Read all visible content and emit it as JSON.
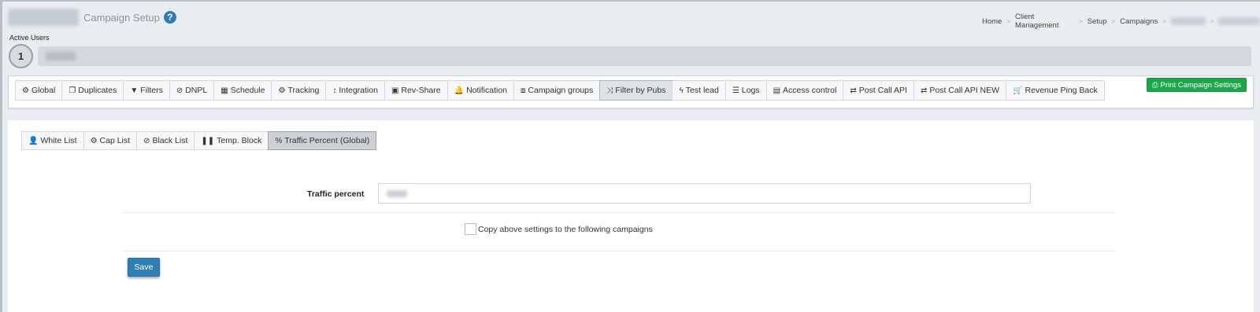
{
  "header": {
    "title": "Campaign Setup",
    "help_icon": "question-circle-icon"
  },
  "breadcrumb": [
    "Home",
    "Client Management",
    "Setup",
    "Campaigns"
  ],
  "active_users": {
    "label": "Active Users",
    "count": "1"
  },
  "tabs": [
    {
      "label": "Global",
      "icon": "cogs-icon",
      "glyph": "⚙",
      "active": false
    },
    {
      "label": "Duplicates",
      "icon": "copy-icon",
      "glyph": "❐",
      "active": false
    },
    {
      "label": "Filters",
      "icon": "filter-icon",
      "glyph": "▼",
      "active": false
    },
    {
      "label": "DNPL",
      "icon": "ban-icon",
      "glyph": "⊘",
      "active": false
    },
    {
      "label": "Schedule",
      "icon": "calendar-icon",
      "glyph": "▦",
      "active": false
    },
    {
      "label": "Tracking",
      "icon": "cogs-icon",
      "glyph": "⚙",
      "active": false
    },
    {
      "label": "Integration",
      "icon": "arrows-v-icon",
      "glyph": "↕",
      "active": false
    },
    {
      "label": "Rev-Share",
      "icon": "money-icon",
      "glyph": "▣",
      "active": false
    },
    {
      "label": "Notification",
      "icon": "bell-icon",
      "glyph": "🔔",
      "active": false
    },
    {
      "label": "Campaign groups",
      "icon": "object-group-icon",
      "glyph": "⧈",
      "active": false
    },
    {
      "label": "Filter by Pubs",
      "icon": "random-icon",
      "glyph": "⤨",
      "active": true
    },
    {
      "label": "Test lead",
      "icon": "bolt-icon",
      "glyph": "ϟ",
      "active": false
    },
    {
      "label": "Logs",
      "icon": "list-icon",
      "glyph": "☰",
      "active": false
    },
    {
      "label": "Access control",
      "icon": "file-text-icon",
      "glyph": "▤",
      "active": false
    },
    {
      "label": "Post Call API",
      "icon": "exchange-icon",
      "glyph": "⇄",
      "active": false
    },
    {
      "label": "Post Call API NEW",
      "icon": "exchange-icon",
      "glyph": "⇄",
      "active": false
    },
    {
      "label": "Revenue Ping Back",
      "icon": "cart-arrow-down-icon",
      "glyph": "🛒",
      "active": false
    }
  ],
  "print_button": {
    "label": "Print Campaign Settings",
    "icon": "print-icon",
    "color": "#1fa64a"
  },
  "subtabs": [
    {
      "label": "White List",
      "icon": "user-plus-icon",
      "glyph": "👤",
      "active": false
    },
    {
      "label": "Cap List",
      "icon": "cog-icon",
      "glyph": "⚙",
      "active": false
    },
    {
      "label": "Black List",
      "icon": "ban-icon",
      "glyph": "⊘",
      "active": false
    },
    {
      "label": "Temp. Block",
      "icon": "pause-icon",
      "glyph": "❚❚",
      "active": false
    },
    {
      "label": "Traffic Percent (Global)",
      "icon": "percent-icon",
      "glyph": "%",
      "active": true
    }
  ],
  "form": {
    "traffic_label": "Traffic percent",
    "copy_label": "Copy above settings to the following campaigns",
    "copy_checked": false,
    "save_label": "Save"
  },
  "colors": {
    "accent_blue": "#2f7fb4",
    "success_green": "#1fa64a",
    "page_bg": "#e9edf2"
  }
}
